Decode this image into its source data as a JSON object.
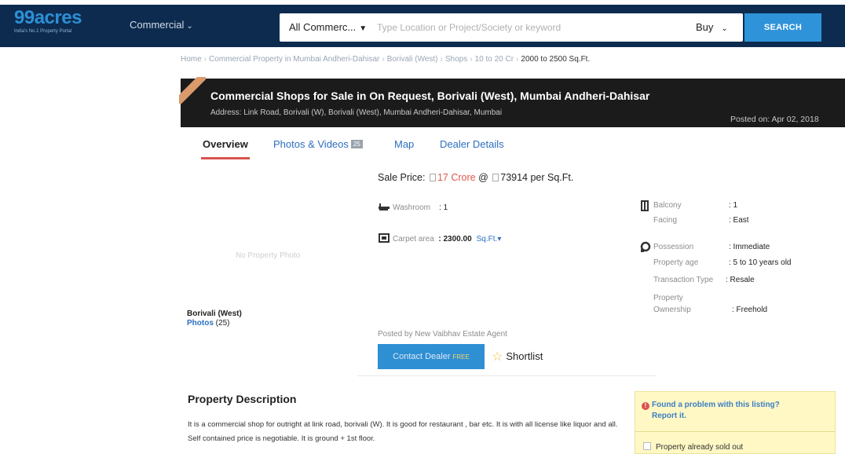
{
  "header": {
    "logo_text": "99acres",
    "logo_tagline": "India's No.1 Property Portal",
    "category_label": "Commercial",
    "search_type": "All Commerc...",
    "search_placeholder": "Type Location or Project/Society or keyword",
    "transaction": "Buy",
    "search_button": "SEARCH"
  },
  "breadcrumb": [
    "Home",
    "Commercial Property in Mumbai Andheri-Dahisar",
    "Borivali (West)",
    "Shops",
    "10 to 20 Cr"
  ],
  "breadcrumb_current": "2000 to 2500 Sq.Ft.",
  "listing": {
    "title": "Commercial Shops for Sale in On Request, Borivali (West), Mumbai Andheri-Dahisar",
    "address": "Address: Link Road, Borivali (W), Borivali (West), Mumbai Andheri-Dahisar, Mumbai",
    "posted_on": "Posted on: Apr 02, 2018"
  },
  "tabs": {
    "overview": "Overview",
    "photos": "Photos & Videos",
    "photos_count": "25",
    "map": "Map",
    "dealer": "Dealer Details"
  },
  "gallery": {
    "no_photo": "No Property Photo",
    "locality": "Borivali (West)",
    "photos_label": "Photos",
    "photos_count": "(25)"
  },
  "price": {
    "label": "Sale Price:",
    "amount": "17 Crore",
    "at": "@",
    "per_sqft": "73914  per Sq.Ft."
  },
  "features": {
    "washroom_label": "Washroom",
    "washroom_value": ": 1",
    "carpet_label": "Carpet area",
    "carpet_value": ": 2300.00",
    "carpet_unit": "Sq.Ft.▾"
  },
  "details": {
    "balcony_label": "Balcony",
    "balcony_value": ": 1",
    "facing_label": "Facing",
    "facing_value": ": East",
    "possession_label": "Possession",
    "possession_value": ": Immediate",
    "age_label": "Property age",
    "age_value": ": 5 to 10 years old",
    "transaction_label": "Transaction Type",
    "transaction_value": ": Resale",
    "ownership_label_1": "Property",
    "ownership_label_2": "Ownership",
    "ownership_value": ": Freehold"
  },
  "dealer": {
    "posted_by": "Posted by New Vaibhav Estate Agent",
    "contact_button": "Contact Dealer",
    "free_tag": "FREE",
    "shortlist": "Shortlist"
  },
  "description": {
    "heading": "Property Description",
    "text": "It is a commercial shop for outright at link road, borivali (W). It is good for restaurant , bar etc. It is with all license like liquor and all. Self contained price is negotiable. It is ground + 1st floor."
  },
  "report": {
    "line1": "Found a problem with this listing?",
    "line2": "Report it.",
    "option": "Property already sold out"
  },
  "colors": {
    "header_bg": "#0d2b4f",
    "brand_blue": "#2f93d9",
    "price_red": "#e0564a",
    "title_bar": "#1b1b1b"
  }
}
